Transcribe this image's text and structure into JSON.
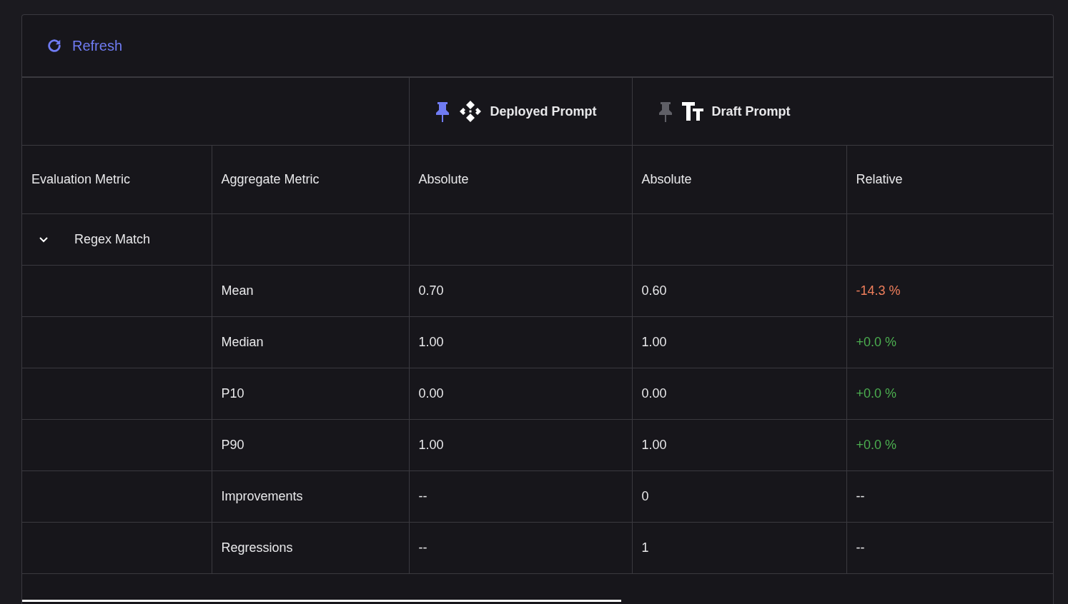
{
  "toolbar": {
    "refresh_label": "Refresh"
  },
  "prompts": [
    {
      "name": "Deployed Prompt",
      "kind": "deployment",
      "pinned": true
    },
    {
      "name": "Draft Prompt",
      "kind": "text",
      "pinned": false
    }
  ],
  "columns": [
    "Evaluation Metric",
    "Aggregate Metric",
    "Absolute",
    "Absolute",
    "Relative"
  ],
  "groups": [
    {
      "name": "Regex Match",
      "expanded": true,
      "rows": [
        {
          "metric": "Mean",
          "deployed": "0.70",
          "draft": "0.60",
          "relative": "-14.3 %",
          "color": "#f07f5c"
        },
        {
          "metric": "Median",
          "deployed": "1.00",
          "draft": "1.00",
          "relative": "+0.0 %",
          "color": "#4caf50"
        },
        {
          "metric": "P10",
          "deployed": "0.00",
          "draft": "0.00",
          "relative": "+0.0 %",
          "color": "#4caf50"
        },
        {
          "metric": "P90",
          "deployed": "1.00",
          "draft": "1.00",
          "relative": "+0.0 %",
          "color": "#4caf50"
        },
        {
          "metric": "Improvements",
          "deployed": "--",
          "draft": "0",
          "relative": "--",
          "color": "#e8e8ea"
        },
        {
          "metric": "Regressions",
          "deployed": "--",
          "draft": "1",
          "relative": "--",
          "color": "#e8e8ea"
        }
      ]
    }
  ]
}
